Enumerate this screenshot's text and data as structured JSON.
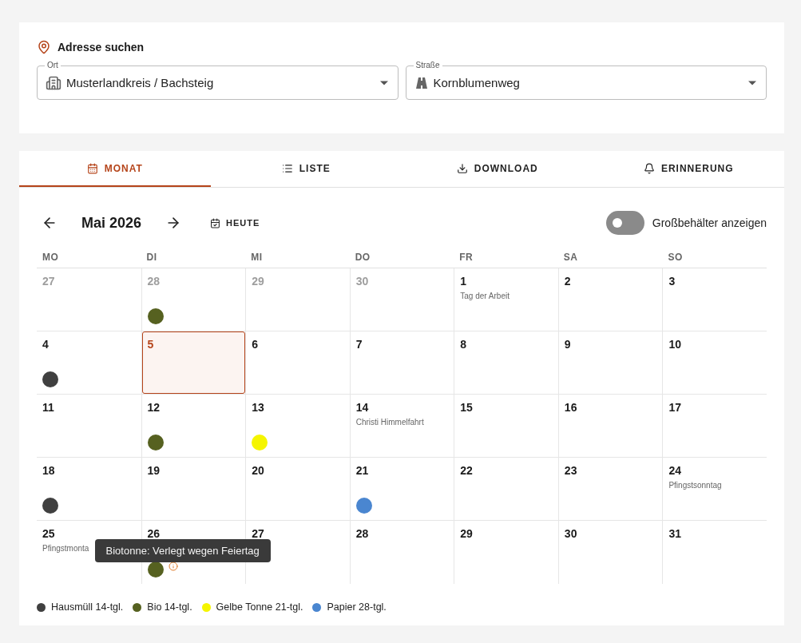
{
  "address": {
    "title": "Adresse suchen",
    "fields": [
      {
        "label": "Ort",
        "value": "Musterlandkreis / Bachsteig",
        "kind": "city"
      },
      {
        "label": "Straße",
        "value": "Kornblumenweg",
        "kind": "street"
      }
    ]
  },
  "tabs": [
    {
      "label": "MONAT",
      "selected": true
    },
    {
      "label": "LISTE",
      "selected": false
    },
    {
      "label": "DOWNLOAD",
      "selected": false
    },
    {
      "label": "ERINNERUNG",
      "selected": false
    }
  ],
  "toolbar": {
    "month": "Mai 2026",
    "today": "HEUTE",
    "toggle": {
      "label": "Großbehälter anzeigen",
      "on": false
    }
  },
  "weekdays": [
    "MO",
    "DI",
    "MI",
    "DO",
    "FR",
    "SA",
    "SO"
  ],
  "weeks": [
    [
      {
        "day": "27",
        "muted": true
      },
      {
        "day": "28",
        "muted": true,
        "pickups": [
          {
            "color": "#566120"
          }
        ]
      },
      {
        "day": "29",
        "muted": true
      },
      {
        "day": "30",
        "muted": true
      },
      {
        "day": "1",
        "holiday": "Tag der Arbeit"
      },
      {
        "day": "2"
      },
      {
        "day": "3"
      }
    ],
    [
      {
        "day": "4",
        "pickups": [
          {
            "color": "#404040"
          }
        ]
      },
      {
        "day": "5",
        "today": true
      },
      {
        "day": "6"
      },
      {
        "day": "7"
      },
      {
        "day": "8"
      },
      {
        "day": "9"
      },
      {
        "day": "10"
      }
    ],
    [
      {
        "day": "11"
      },
      {
        "day": "12",
        "pickups": [
          {
            "color": "#566120"
          }
        ]
      },
      {
        "day": "13",
        "pickups": [
          {
            "color": "#f5f500"
          }
        ]
      },
      {
        "day": "14",
        "holiday": "Christi Himmelfahrt"
      },
      {
        "day": "15"
      },
      {
        "day": "16"
      },
      {
        "day": "17"
      }
    ],
    [
      {
        "day": "18",
        "pickups": [
          {
            "color": "#404040"
          }
        ]
      },
      {
        "day": "19"
      },
      {
        "day": "20"
      },
      {
        "day": "21",
        "pickups": [
          {
            "color": "#4a86d0"
          }
        ]
      },
      {
        "day": "22"
      },
      {
        "day": "23"
      },
      {
        "day": "24",
        "holiday": "Pfingstsonntag"
      }
    ],
    [
      {
        "day": "25",
        "holiday": "Pfingstmonta"
      },
      {
        "day": "26",
        "pickups": [
          {
            "color": "#566120",
            "info": true
          }
        ]
      },
      {
        "day": "27"
      },
      {
        "day": "28"
      },
      {
        "day": "29"
      },
      {
        "day": "30"
      },
      {
        "day": "31"
      }
    ]
  ],
  "tooltip": "Biotonne: Verlegt wegen Feiertag",
  "legend": [
    {
      "label": "Hausmüll 14-tgl.",
      "color": "#404040"
    },
    {
      "label": "Bio 14-tgl.",
      "color": "#566120"
    },
    {
      "label": "Gelbe Tonne 21-tgl.",
      "color": "#f5f500"
    },
    {
      "label": "Papier 28-tgl.",
      "color": "#4a86d0"
    }
  ]
}
